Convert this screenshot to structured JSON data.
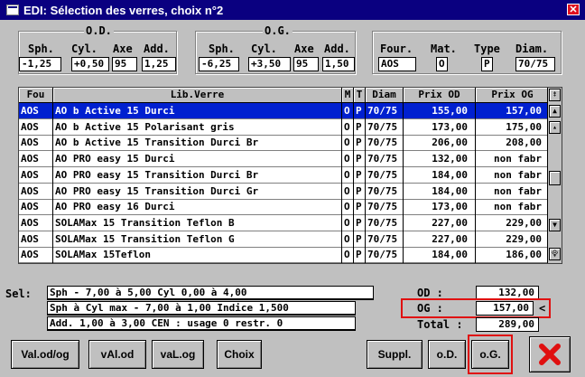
{
  "window": {
    "title": "EDI: Sélection des verres, choix n°2",
    "close_icon": "close-icon"
  },
  "od": {
    "legend": "O.D.",
    "sph_label": "Sph.",
    "cyl_label": "Cyl.",
    "axe_label": "Axe",
    "add_label": "Add.",
    "sph": "-1,25",
    "cyl": "+0,50",
    "axe": "95",
    "add": "1,25"
  },
  "og": {
    "legend": "O.G.",
    "sph_label": "Sph.",
    "cyl_label": "Cyl.",
    "axe_label": "Axe",
    "add_label": "Add.",
    "sph": "-6,25",
    "cyl": "+3,50",
    "axe": "95",
    "add": "1,50"
  },
  "filters": {
    "four_label": "Four.",
    "mat_label": "Mat.",
    "type_label": "Type",
    "diam_label": "Diam.",
    "four": "AOS",
    "mat": "O",
    "type": "P",
    "diam": "70/75"
  },
  "table": {
    "headers": [
      "Fou",
      "Lib.Verre",
      "M",
      "T",
      "Diam",
      "Prix OD",
      "Prix OG"
    ],
    "rows": [
      [
        "AOS",
        "AO b Active 15 Durci",
        "O",
        "P",
        "70/75",
        "155,00",
        "157,00"
      ],
      [
        "AOS",
        "AO b Active 15 Polarisant gris",
        "O",
        "P",
        "70/75",
        "173,00",
        "175,00"
      ],
      [
        "AOS",
        "AO b Active 15 Transition Durci Br",
        "O",
        "P",
        "70/75",
        "206,00",
        "208,00"
      ],
      [
        "AOS",
        "AO PRO easy 15 Durci",
        "O",
        "P",
        "70/75",
        "132,00",
        "non fabr"
      ],
      [
        "AOS",
        "AO PRO easy 15 Transition Durci Br",
        "O",
        "P",
        "70/75",
        "184,00",
        "non fabr"
      ],
      [
        "AOS",
        "AO PRO easy 15 Transition Durci Gr",
        "O",
        "P",
        "70/75",
        "184,00",
        "non fabr"
      ],
      [
        "AOS",
        "AO PRO easy 16  Durci",
        "O",
        "P",
        "70/75",
        "173,00",
        "non fabr"
      ],
      [
        "AOS",
        "SOLAMax 15 Transition Teflon B",
        "O",
        "P",
        "70/75",
        "227,00",
        "229,00"
      ],
      [
        "AOS",
        "SOLAMax 15 Transition Teflon G",
        "O",
        "P",
        "70/75",
        "227,00",
        "229,00"
      ],
      [
        "AOS",
        "SOLAMax 15Teflon",
        "O",
        "P",
        "70/75",
        "184,00",
        "186,00"
      ]
    ]
  },
  "sel": {
    "label": "Sel:",
    "line1": "Sph - 7,00 à   5,00 Cyl  0,00 à  4,00",
    "line2": "Sph à Cyl max - 7,00 à   1,00  Indice 1,500",
    "line3": "Add.  1,00 à  3,00  CEN : usage 0 restr. 0"
  },
  "totals": {
    "od_label": "OD :",
    "od": "132,00",
    "og_label": "OG :",
    "og": "157,00",
    "og_marker": "<",
    "total_label": "Total :",
    "total": "289,00"
  },
  "buttons": {
    "valodog": "Val.od/og",
    "valod": "vAl.od",
    "valog": "vaL.og",
    "choix": "Choix",
    "suppl": "Suppl.",
    "od": "o.D.",
    "og": "o.G.",
    "cancel_icon": "cancel-x-icon"
  }
}
